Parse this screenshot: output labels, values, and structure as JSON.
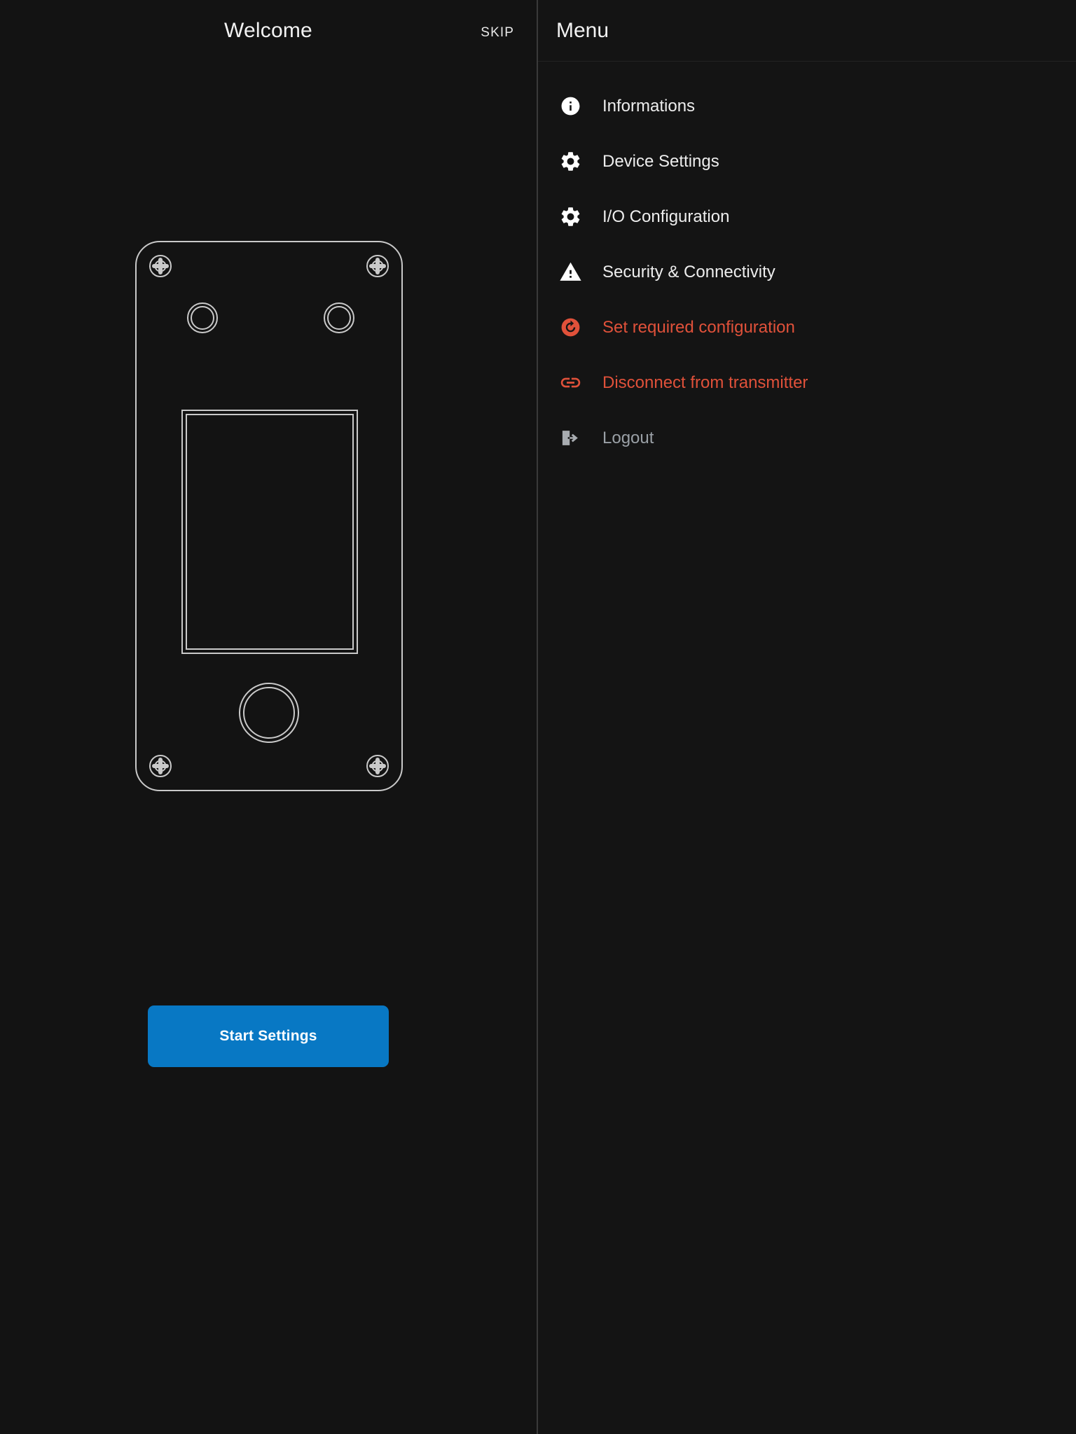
{
  "header": {
    "title": "Welcome",
    "skip_label": "SKIP"
  },
  "main": {
    "start_button_label": "Start Settings",
    "device_illustration": {
      "name": "access-control-terminal-outline",
      "outline_color": "#c9c9c9",
      "parts": [
        "screw-top-left",
        "screw-top-right",
        "sensor-hole-left",
        "sensor-hole-right",
        "display-panel",
        "fingerprint-button",
        "screw-bottom-left",
        "screw-bottom-right"
      ]
    }
  },
  "menu": {
    "title": "Menu",
    "items": [
      {
        "label": "Informations",
        "icon": "info-icon",
        "tone": "default"
      },
      {
        "label": "Device Settings",
        "icon": "gear-icon",
        "tone": "default"
      },
      {
        "label": "I/O Configuration",
        "icon": "gear-icon",
        "tone": "default"
      },
      {
        "label": "Security & Connectivity",
        "icon": "warning-icon",
        "tone": "default"
      },
      {
        "label": "Set required configuration",
        "icon": "refresh-icon",
        "tone": "danger"
      },
      {
        "label": "Disconnect from transmitter",
        "icon": "link-icon",
        "tone": "danger"
      },
      {
        "label": "Logout",
        "icon": "logout-icon",
        "tone": "muted"
      }
    ]
  },
  "colors": {
    "background": "#121212",
    "panel": "#141414",
    "accent_blue": "#0878c4",
    "danger_red": "#e0513a",
    "muted_gray": "#9aa0a6",
    "text_primary": "#ededed",
    "divider": "#3a3a3a"
  }
}
